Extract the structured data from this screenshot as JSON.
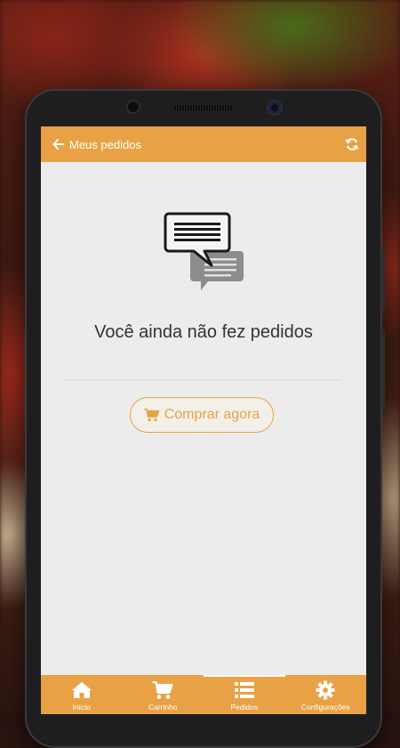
{
  "header": {
    "title": "Meus pedidos"
  },
  "empty_state": {
    "message": "Você ainda não fez pedidos",
    "cta_label": "Comprar agora"
  },
  "tabs": [
    {
      "label": "Início",
      "icon": "home-icon"
    },
    {
      "label": "Carrinho",
      "icon": "cart-icon"
    },
    {
      "label": "Pedidos",
      "icon": "list-icon",
      "active": true
    },
    {
      "label": "Configurações",
      "icon": "gear-icon"
    }
  ],
  "colors": {
    "accent": "#e8a245",
    "background": "#ececec",
    "text": "#333333"
  }
}
